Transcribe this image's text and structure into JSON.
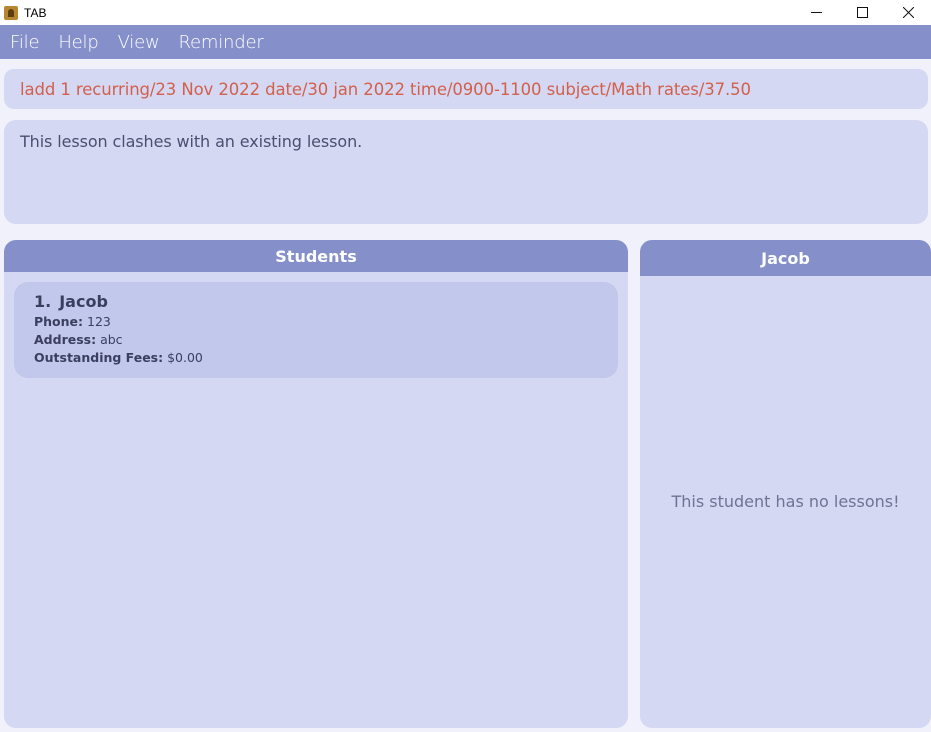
{
  "window": {
    "title": "TAB",
    "icon": "app-icon",
    "controls": [
      "minimize-icon",
      "maximize-icon",
      "close-icon"
    ]
  },
  "menu": {
    "items": [
      {
        "label": "File"
      },
      {
        "label": "Help"
      },
      {
        "label": "View"
      },
      {
        "label": "Reminder"
      }
    ]
  },
  "command": {
    "value": "ladd 1 recurring/23 Nov 2022 date/30 jan 2022 time/0900-1100 subject/Math rates/37.50"
  },
  "result": {
    "message": "This lesson clashes with an existing lesson."
  },
  "students": {
    "header": "Students",
    "list": [
      {
        "index": "1.",
        "name": "Jacob",
        "phone_label": "Phone:",
        "phone": "123",
        "address_label": "Address:",
        "address": "abc",
        "fees_label": "Outstanding Fees:",
        "fees": "$0.00"
      }
    ]
  },
  "lessons": {
    "header": "Jacob",
    "empty_message": "This student has no lessons!"
  },
  "colors": {
    "accent": "#8590cb",
    "panel": "#d4d8f2",
    "card": "#c2c8eb",
    "command_text": "#d2604c"
  }
}
